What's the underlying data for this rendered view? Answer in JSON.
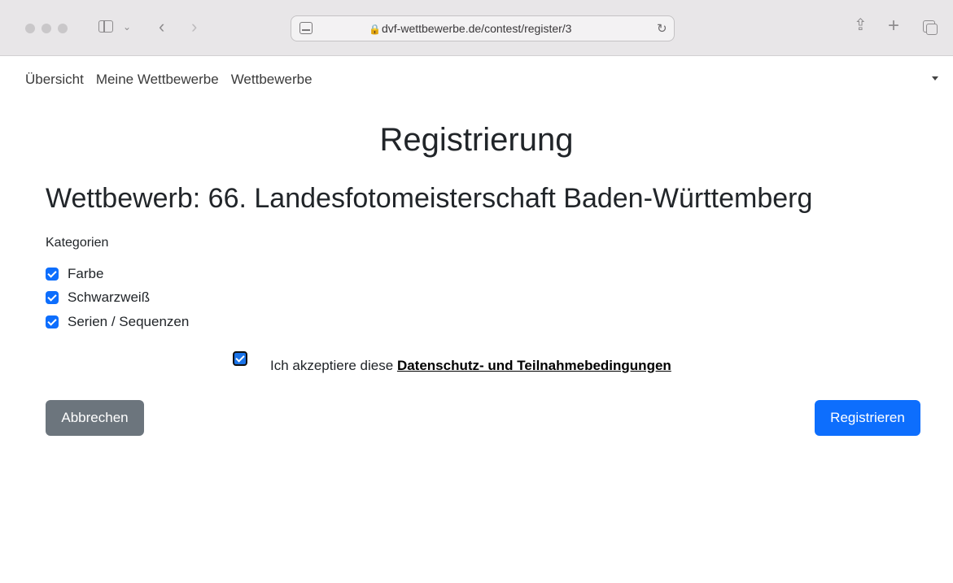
{
  "browser": {
    "url": "dvf-wettbewerbe.de/contest/register/3"
  },
  "nav": {
    "items": [
      "Übersicht",
      "Meine Wettbewerbe",
      "Wettbewerbe"
    ]
  },
  "page": {
    "title": "Registrierung",
    "contest_heading": "Wettbewerb: 66. Landesfotomeisterschaft Baden-Württemberg",
    "categories_label": "Kategorien",
    "categories": [
      {
        "label": "Farbe",
        "checked": true
      },
      {
        "label": "Schwarzweiß",
        "checked": true
      },
      {
        "label": "Serien / Sequenzen",
        "checked": true
      }
    ],
    "accept_prefix": "Ich akzeptiere diese",
    "accept_link": "Datenschutz- und Teilnahmebedingungen",
    "accept_checked": true,
    "cancel_label": "Abbrechen",
    "register_label": "Registrieren"
  },
  "colors": {
    "primary": "#0d6efd",
    "secondary": "#6c757d"
  }
}
